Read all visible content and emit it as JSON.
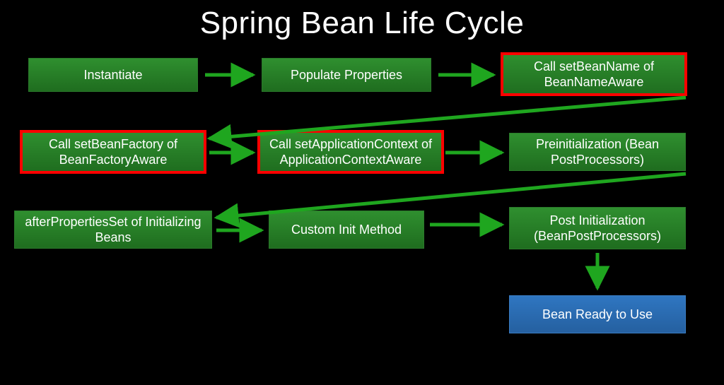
{
  "title": "Spring Bean Life Cycle",
  "boxes": {
    "instantiate": "Instantiate",
    "populate": "Populate Properties",
    "setBeanName": "Call setBeanName of BeanNameAware",
    "setBeanFactory": "Call setBeanFactory of BeanFactoryAware",
    "setAppContext": "Call setApplicationContext of ApplicationContextAware",
    "preinit": "Preinitialization (Bean PostProcessors)",
    "afterProps": "afterPropertiesSet of Initializing Beans",
    "customInit": "Custom Init Method",
    "postInit": "Post Initialization (BeanPostProcessors)",
    "ready": "Bean Ready to Use"
  },
  "colors": {
    "arrow": "#1fa61f",
    "highlight": "#ff0000"
  }
}
